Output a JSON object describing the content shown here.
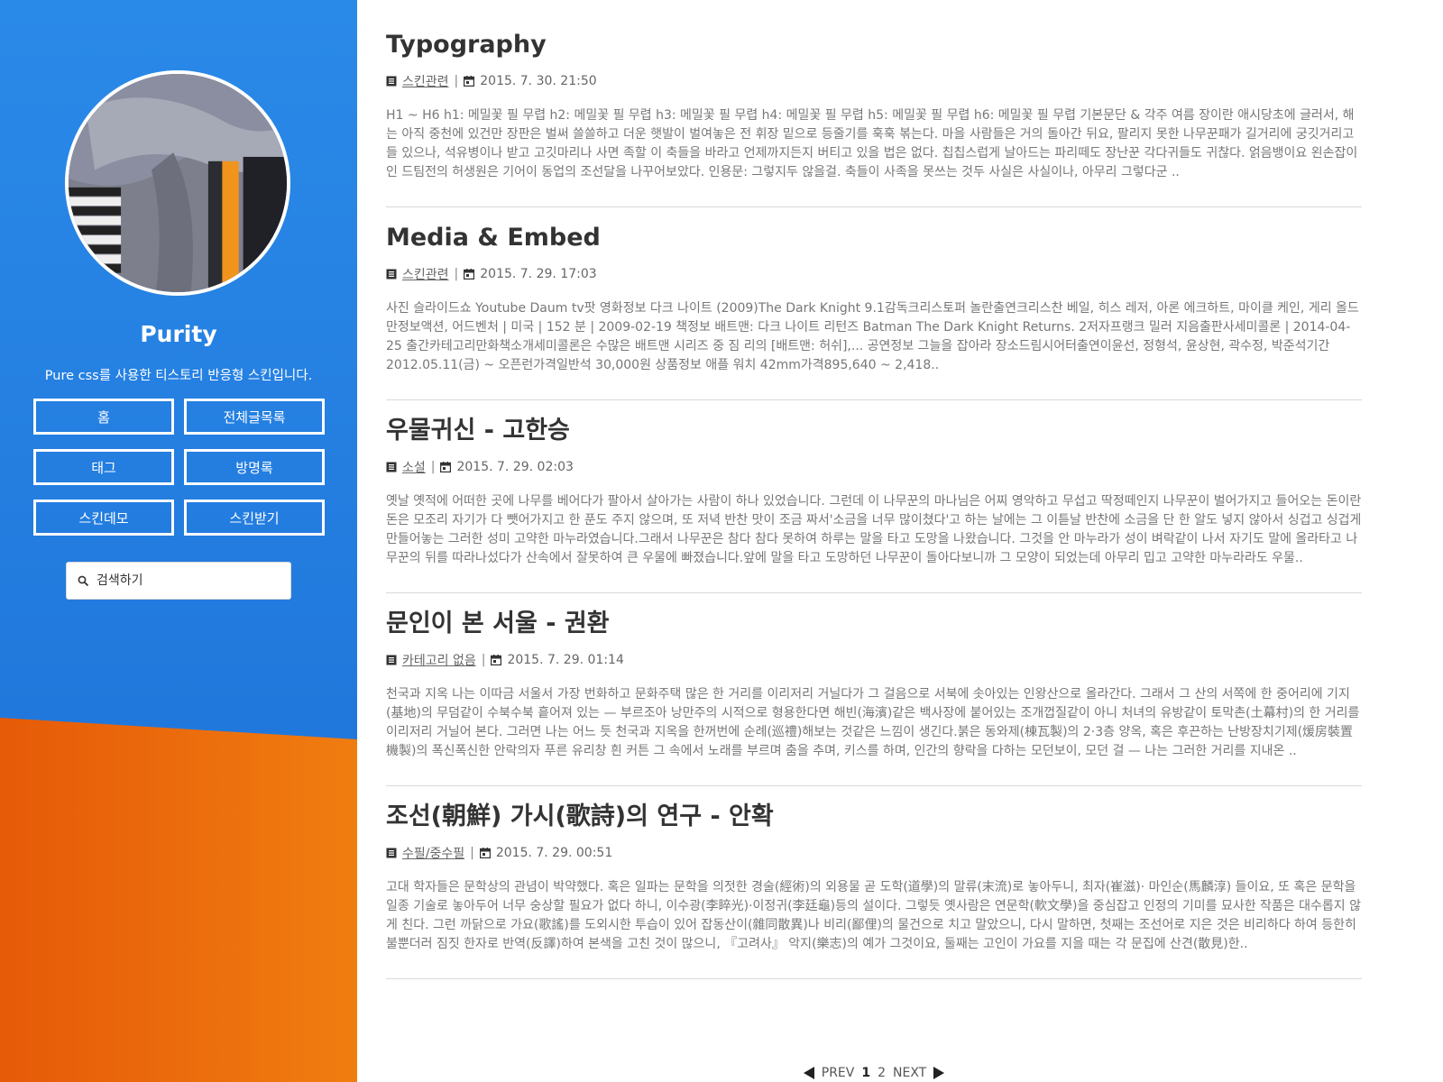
{
  "theme": {
    "sidebar_blue": "#2a8ae8",
    "sidebar_orange": "#e65a08"
  },
  "sidebar": {
    "blog_name": "Purity",
    "description": "Pure css를 사용한 티스토리 반응형 스킨입니다.",
    "nav": [
      {
        "label": "홈"
      },
      {
        "label": "전체글목록"
      },
      {
        "label": "태그"
      },
      {
        "label": "방명록"
      },
      {
        "label": "스킨데모"
      },
      {
        "label": "스킨받기"
      }
    ],
    "search": {
      "placeholder": "검색하기",
      "icon": "search-icon"
    }
  },
  "posts": [
    {
      "title": "Typography",
      "category": "스킨관련",
      "date": "2015. 7. 30. 21:50",
      "excerpt": "H1 ~ H6 h1: 메밀꽃 필 무렵 h2: 메밀꽃 필 무렵 h3: 메밀꽃 필 무렵 h4: 메밀꽃 필 무렵 h5: 메밀꽃 필 무렵 h6: 메밀꽃 필 무렵 기본문단 & 각주 여름 장이란 애시당초에 글러서, 해는 아직 중천에 있건만 장판은 벌써 쓸쓸하고 더운 햇발이 벌여놓은 전 휘장 밑으로 등줄기를 훅훅 볶는다. 마을 사람들은 거의 돌아간 뒤요, 팔리지 못한 나무꾼패가 길거리에 궁깃거리고들 있으나, 석유병이나 받고 고깃마리나 사면 족할 이 축들을 바라고 언제까지든지 버티고 있을 법은 없다. 칩칩스럽게 날아드는 파리떼도 장난꾼 각다귀들도 귀찮다. 얽음뱅이요 왼손잡이인 드팀전의 허생원은 기어이 동업의 조선달을 나꾸어보았다. 인용문: 그렇지두 않을걸. 축들이 사족을 못쓰는 것두 사실은 사실이나, 아무리 그렇다군 .."
    },
    {
      "title": "Media & Embed",
      "category": "스킨관련",
      "date": "2015. 7. 29. 17:03",
      "excerpt": "사진 슬라이드쇼 Youtube Daum tv팟 영화정보 다크 나이트 (2009)The Dark Knight 9.1감독크리스토퍼 놀란출연크리스찬 베일, 히스 레저, 아론 에크하트, 마이클 케인, 게리 올드만정보액션, 어드벤처 | 미국 | 152 분 | 2009-02-19 책정보 배트맨: 다크 나이트 리턴즈 Batman The Dark Knight Returns. 2저자프랭크 밀러 지음출판사세미콜론 | 2014-04-25 출간카테고리만화책소개세미콜론은 수많은 배트맨 시리즈 중 짐 리의 [배트맨: 허쉬],... 공연정보 그늘을 잡아라 장소드림시어터출연이윤선, 정형석, 윤상현, 곽수정, 박준석기간2012.05.11(금) ~ 오픈런가격일반석 30,000원 상품정보 애플 워치 42mm가격895,640 ~ 2,418.."
    },
    {
      "title": "우물귀신 - 고한승",
      "category": "소설",
      "date": "2015. 7. 29. 02:03",
      "excerpt": "옛날 옛적에 어떠한 곳에 나무를 베어다가 팔아서 살아가는 사람이 하나 있었습니다. 그런데 이 나무꾼의 마나님은 어찌 영악하고 무섭고 딱정떼인지 나무꾼이 벌어가지고 들어오는 돈이란 돈은 모조리 자기가 다 뺏어가지고 한 푼도 주지 않으며, 또 저녁 반찬 맛이 조금 짜서'소금을 너무 많이쳤다'고 하는 날에는 그 이튿날 반찬에 소금을 단 한 알도 넣지 않아서 싱겁고 싱겁게 만들어놓는 그러한 성미 고약한 마누라였습니다.그래서 나무꾼은 참다 참다 못하여 하루는 말을 타고 도망을 나왔습니다. 그것을 안 마누라가 성이 벼락같이 나서 자기도 말에 올라타고 나무꾼의 뒤를 따라나섰다가 산속에서 잘못하여 큰 우물에 빠졌습니다.앞에 말을 타고 도망하던 나무꾼이 돌아다보니까 그 모양이 되었는데 아무리 밉고 고약한 마누라라도 우물.."
    },
    {
      "title": "문인이 본 서울 - 권환",
      "category": "카테고리 없음",
      "date": "2015. 7. 29. 01:14",
      "excerpt": "천국과 지옥 나는 이따금 서울서 가장 번화하고 문화주택 많은 한 거리를 이리저리 거닐다가 그 걸음으로 서북에 솟아있는 인왕산으로 올라간다. 그래서 그 산의 서쪽에 한 중어리에 기지(基地)의 무덤같이 수북수북 흩어져 있는 — 부르조아 낭만주의 시적으로 형용한다면 해빈(海濱)같은 백사장에 붙어있는 조개껍질같이 아니 처녀의 유방같이 토막촌(土幕村)의 한 거리를 이리저리 거닐어 본다. 그러면 나는 어느 듯 천국과 지옥을 한꺼번에 순례(巡禮)해보는 것같은 느낌이 생긴다.붉은 동와제(棟瓦製)의 2·3층 양옥, 혹은 후끈하는 난방장치기제(煖房裝置機製)의 폭신폭신한 안락의자 푸른 유리창 흰 커튼 그 속에서 노래를 부르며 춤을 추며, 키스를 하며, 인간의 향락을 다하는 모던보이, 모던 걸 — 나는 그러한 거리를 지내온 .."
    },
    {
      "title": "조선(朝鮮) 가시(歌詩)의 연구 - 안확",
      "category": "수필/중수필",
      "date": "2015. 7. 29. 00:51",
      "excerpt": "고대 학자들은 문학상의 관념이 박약했다. 혹은 일파는 문학을 의젓한 경술(經術)의 외용물 곧 도학(道學)의 말류(末流)로 놓아두니, 최자(崔滋)· 마인순(馬麟淳) 들이요, 또 혹은 문학을 일종 기술로 놓아두어 너무 숭상할 필요가 없다 하니, 이수광(李睟光)·이정귀(李廷龜)등의 설이다. 그렇듯 옛사람은 연문학(軟文學)을 중심잡고 인정의 기미를 묘사한 작품은 대수롭지 않게 친다. 그런 까닭으로 가요(歌謠)를 도외시한 투습이 있어 잡동산이(雜同散異)나 비리(鄙俚)의 물건으로 치고 말았으니, 다시 말하면, 첫째는 조선어로 지은 것은 비리하다 하여 등한히 불뿐더러 짐짓 한자로 반역(反譯)하여 본색을 고친 것이 많으니, 『고려사』 악지(樂志)의 예가 그것이요, 둘째는 고인이 가요를 지을 때는 각 문집에 산견(散見)한.."
    }
  ],
  "pagination": {
    "prev": "PREV",
    "pages": [
      "1",
      "2"
    ],
    "current": "1",
    "next": "NEXT"
  }
}
